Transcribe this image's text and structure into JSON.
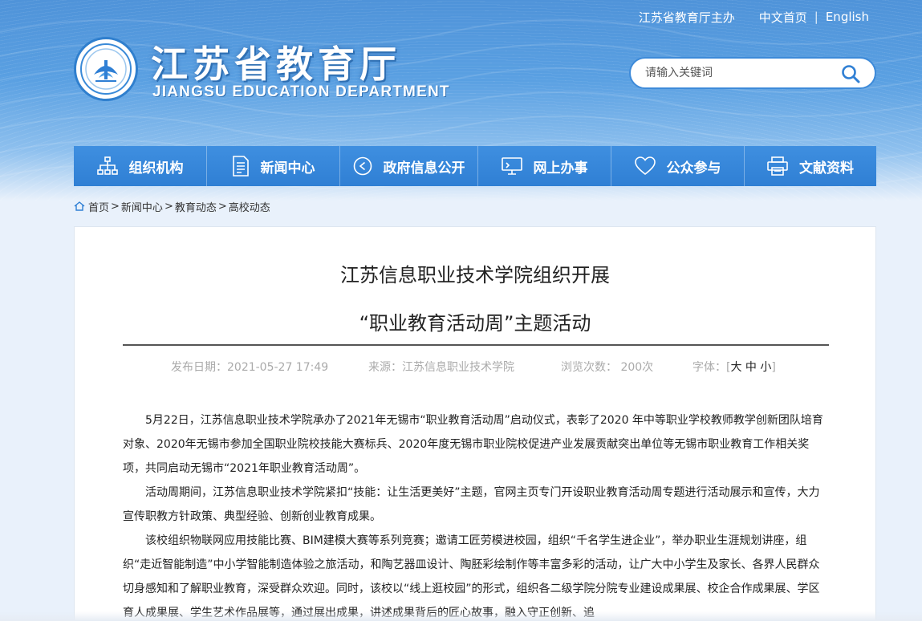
{
  "header": {
    "host_link": "江苏省教育厅主办",
    "lang_cn": "中文首页",
    "lang_sep": "|",
    "lang_en": "English",
    "title": "江苏省教育厅",
    "subtitle": "JIANGSU EDUCATION DEPARTMENT"
  },
  "search": {
    "placeholder": "请输入关键词"
  },
  "nav": [
    {
      "label": "组织机构",
      "icon": "org-chart-icon"
    },
    {
      "label": "新闻中心",
      "icon": "document-icon"
    },
    {
      "label": "政府信息公开",
      "icon": "play-circle-icon"
    },
    {
      "label": "网上办事",
      "icon": "monitor-icon"
    },
    {
      "label": "公众参与",
      "icon": "heart-icon"
    },
    {
      "label": "文献资料",
      "icon": "printer-icon"
    }
  ],
  "breadcrumb": [
    "首页",
    "新闻中心",
    "教育动态",
    "高校动态"
  ],
  "article": {
    "title_line1": "江苏信息职业技术学院组织开展",
    "title_line2": "“职业教育活动周”主题活动",
    "date": "发布日期：2021-05-27 17:49",
    "source": "来源：江苏信息职业技术学院",
    "views": "浏览次数：  200次",
    "font_label": "字体：[",
    "font_large": "大",
    "font_medium": "中",
    "font_small": "小",
    "font_close": "]",
    "paragraphs": [
      "5月22日，江苏信息职业技术学院承办了2021年无锡市“职业教育活动周”启动仪式，表彰了2020 年中等职业学校教师教学创新团队培育对象、2020年无锡市参加全国职业院校技能大赛标兵、2020年度无锡市职业院校促进产业发展贡献突出单位等无锡市职业教育工作相关奖项，共同启动无锡市“2021年职业教育活动周”。",
      "活动周期间，江苏信息职业技术学院紧扣“技能：让生活更美好”主题，官网主页专门开设职业教育活动周专题进行活动展示和宣传，大力宣传职教方针政策、典型经验、创新创业教育成果。",
      "该校组织物联网应用技能比赛、BIM建模大赛等系列竞赛；邀请工匠劳模进校园，组织“千名学生进企业”，举办职业生涯规划讲座，组织“走近智能制造”中小学智能制造体验之旅活动，和陶艺器皿设计、陶胚彩绘制作等丰富多彩的活动，让广大中小学生及家长、各界人民群众切身感知和了解职业教育，深受群众欢迎。同时，该校以“线上逛校园”的形式，组织各二级学院分院专业建设成果展、校企合作成果展、学区育人成果展、学生艺术作品展等，通过展出成果，讲述成果背后的匠心故事，融入守正创新、追"
    ]
  },
  "colors": {
    "nav_bg": "#2f7fd4",
    "header_blue": "#4f93d9",
    "page_bg": "#e9f1fb"
  }
}
